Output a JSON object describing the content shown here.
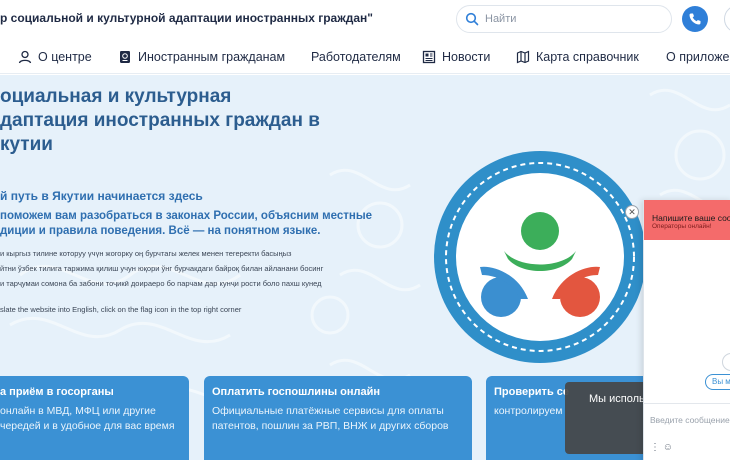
{
  "header": {
    "site_title": "р социальной и культурной адаптации иностранных граждан\"",
    "search_placeholder": "Найти"
  },
  "nav": {
    "items": [
      {
        "label": "О центре",
        "icon": "user-icon"
      },
      {
        "label": "Иностранным гражданам",
        "icon": "passport-icon"
      },
      {
        "label": "Работодателям",
        "icon": ""
      },
      {
        "label": "Новости",
        "icon": "newspaper-icon"
      },
      {
        "label": "Карта справочник",
        "icon": "map-icon"
      },
      {
        "label": "О приложе",
        "icon": ""
      }
    ]
  },
  "hero": {
    "title_lines": [
      "оциальная и культурная",
      "даптация иностранных граждан в",
      "кутии"
    ],
    "subtitle": "й путь в Якутии начинается здесь",
    "description_lines": [
      "поможем вам разобраться в законах России, объясним местные",
      "диции и правила поведения. Всё — на понятном языке."
    ],
    "language_hints": [
      "и кыргыз тилине которуу үчүн жогорку оң бурчтагы желек менен тегеректи басыңыз",
      "йтни ўзбек тилига таржима қилиш учун юқори ўнг бурчакдаги байроқ билан айланани босинг",
      "и тарҷумаи сомона ба забони тоҷикӣ доираеро бо парчам дар кунҷи рости боло пахш кунед",
      "slate the website into English, click on the flag icon in the top right corner"
    ]
  },
  "cards": [
    {
      "title": "а приём  в госорганы",
      "text_lines": [
        "онлайн в МВД, МФЦ или другие",
        "чередей и в удобное для вас время"
      ]
    },
    {
      "title": "Оплатить госпошлины онлайн",
      "text_lines": [
        "Официальные платёжные сервисы для оплаты",
        "патентов, пошлин за РВП, ВНЖ и других сборов"
      ]
    },
    {
      "title": "Проверить се",
      "text_lines": [
        "контролируем"
      ]
    }
  ],
  "cookie": {
    "text": "Мы используе"
  },
  "chat": {
    "header_title": "Напишите ваше сообщ",
    "header_status": "Операторы онлайн!",
    "reply_chip": "Вы м",
    "input_placeholder": "Введите сообщение",
    "colors": {
      "header": "#f46b6b",
      "accent": "#3b91d4"
    }
  },
  "colors": {
    "hero_bg": "#e6f1fa",
    "card_bg": "#3b91d4",
    "emblem_ring": "#2f8fc9",
    "emblem_green": "#3cae5a",
    "emblem_blue": "#3b8fd0",
    "emblem_red": "#e3563f"
  }
}
